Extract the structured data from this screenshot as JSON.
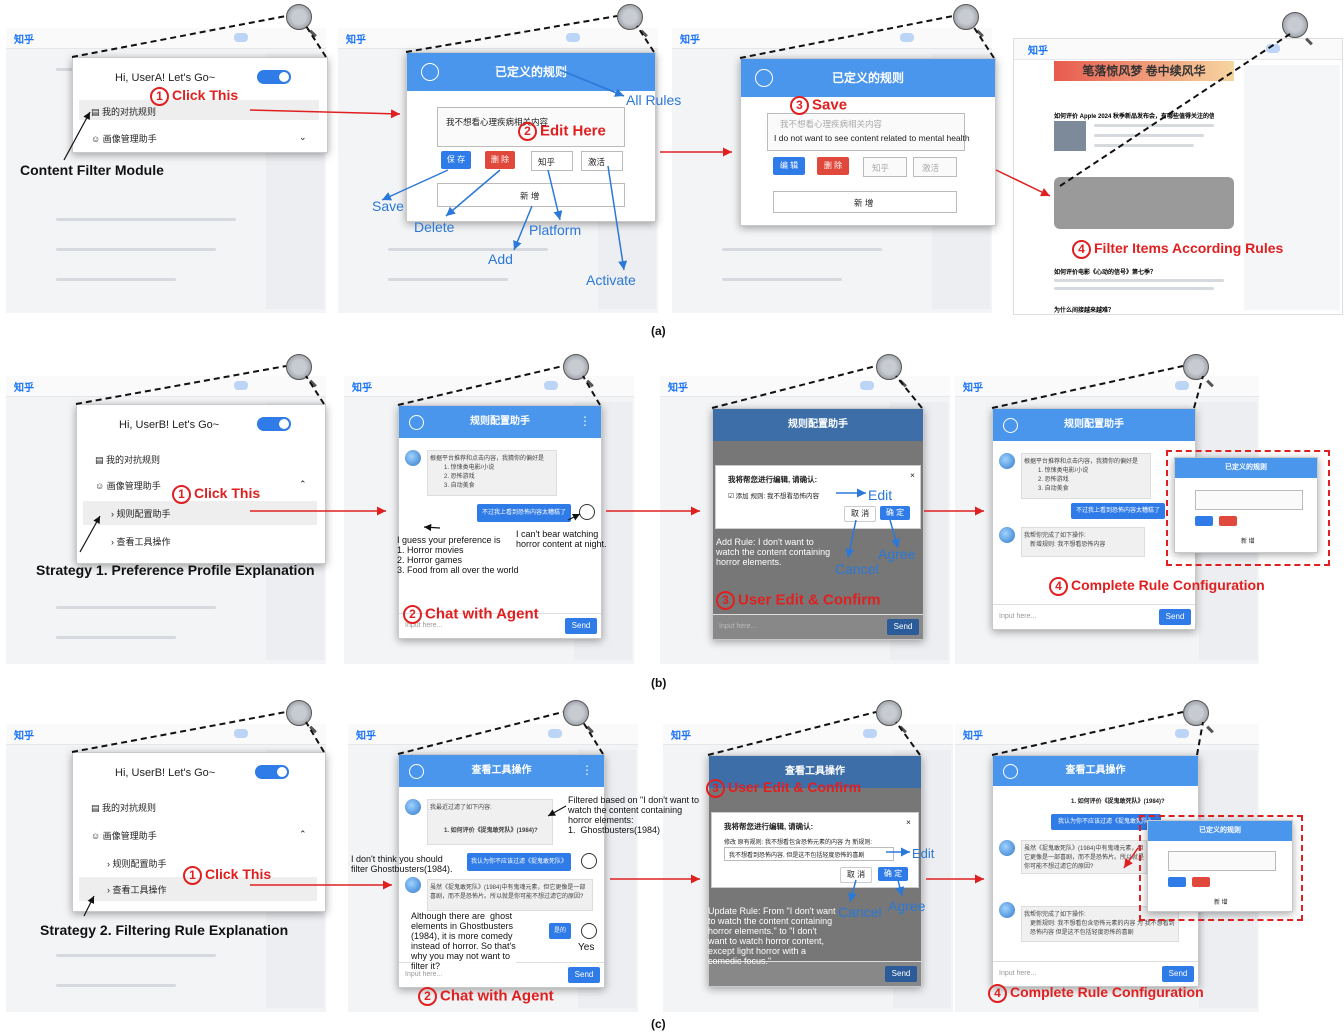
{
  "captions": {
    "a": "(a)",
    "b": "(b)",
    "c": "(c)"
  },
  "app_logo": "知乎",
  "row_a": {
    "home": {
      "greeting": "Hi, UserA! Let's Go~",
      "item1": "我的对抗规则",
      "item2": "画像管理助手"
    },
    "ann_click": "Click This",
    "ann_module": "Content Filter Module",
    "rules_panel": {
      "title": "已定义的规则",
      "rule_text": "我不想看心理疾病相关内容",
      "save": "保 存",
      "delete": "删 除",
      "platform": "知乎",
      "activate": "激活",
      "add": "新 增"
    },
    "ann_all_rules": "All Rules",
    "ann_edit_here": "Edit Here",
    "ann_save_btn": "Save",
    "ann_delete": "Delete",
    "ann_add": "Add",
    "ann_platform": "Platform",
    "ann_activate": "Activate",
    "saved_panel": {
      "title": "已定义的规则",
      "rule_text": "我不想看心理疾病相关内容",
      "rule_en": "I do not want to see content related to mental health",
      "edit": "编 辑",
      "delete": "删 除",
      "platform": "知乎",
      "activate": "激活",
      "add": "新 增"
    },
    "ann_save": "Save",
    "ann_filter": "Filter Items According Rules",
    "feed_question": "如何评价 Apple 2024 秋季新品发布会，有哪些值得关注的信息？",
    "feed_question2": "如何评价电影《心动的信号》第七季？",
    "feed_question3": "为什么间接越来越难？",
    "banner_text": "笔落惊风梦 卷中续风华"
  },
  "row_b": {
    "home": {
      "greeting": "Hi, UserB! Let's Go~",
      "item1": "我的对抗规则",
      "item2": "画像管理助手",
      "sub1": "规则配置助手",
      "sub2": "查看工具操作"
    },
    "ann_click": "Click This",
    "ann_strategy": "Strategy 1. Preference Profile Explanation",
    "chat": {
      "title": "规则配置助手",
      "agent_msg": "根据平台推荐和点击内容，我猜你的偏好是",
      "prefs": [
        "1. 惊悚类电影/小说",
        "2. 恐怖游戏",
        "3. 自动美食"
      ],
      "user_msg": "不过我上看到恐怖内容太糟糕了",
      "input_placeholder": "Input here...",
      "send": "Send"
    },
    "ann_guess": "I guess your preference is\n1. Horror movies\n2. Horror games\n3. Food from all over the world",
    "ann_cant": "I can't bear watching\nhorror content at night.",
    "ann_chat": "Chat with Agent",
    "confirm": {
      "title": "我将帮您进行编辑, 请确认:",
      "rule": "添加 规则: 我不想看恐怖内容",
      "cancel": "取 消",
      "ok": "确 定"
    },
    "ann_edit": "Edit",
    "ann_addrule": "Add Rule: I don't want to\nwatch the content containing\nhorror elements.",
    "ann_cancel": "Cancel",
    "ann_agree": "Agree",
    "ann_user_edit": "User Edit & Confirm",
    "done": {
      "title": "规则配置助手",
      "done_msg": "我帮你完成了如下操作:",
      "done_item": "新增规则: 我不想看恐怖内容"
    },
    "mini": {
      "title": "已定义的规则",
      "add": "新 增"
    },
    "ann_complete": "Complete Rule Configuration"
  },
  "row_c": {
    "home": {
      "greeting": "Hi, UserB! Let's Go~",
      "item1": "我的对抗规则",
      "item2": "画像管理助手",
      "sub1": "规则配置助手",
      "sub2": "查看工具操作"
    },
    "ann_click": "Click This",
    "ann_strategy": "Strategy 2. Filtering Rule Explanation",
    "chat": {
      "title": "查看工具操作",
      "agent_msg": "我最近过滤了如下内容:",
      "filtered": "1. 如何评价《捉鬼敢死队》(1984)?",
      "user_msg": "我认为你不应该过滤《捉鬼敢死队》",
      "agent_msg2": "虽然《捉鬼敢死队》(1984)中有鬼魂元素，但它更像是一部喜剧，而不是恐怖片。所以就是你可能不想过滤它的原因?",
      "yes": "是的",
      "input_placeholder": "Input here...",
      "send": "Send"
    },
    "ann_filtered": "Filtered based on \"I don't want to\nwatch the content containing\nhorror elements:\n1.  Ghostbusters(1984)",
    "ann_dont": "I don't think you should\nfilter Ghostbusters(1984).",
    "ann_although": "Although there are  ghost\nelements in Ghostbusters\n(1984), it is more comedy\ninstead of horror. So that's\nwhy you may not want to\nfilter it?",
    "ann_yes": "Yes",
    "ann_chat": "Chat with Agent",
    "confirm": {
      "title": "我将帮您进行编辑, 请确认:",
      "rule": "修改 原有规则: 我不想看包含恐怖元素的内容 为 新规则:",
      "rule2": "我不想看到恐怖内容, 但是这不包括轻度恐怖的喜剧",
      "cancel": "取 消",
      "ok": "确 定"
    },
    "ann_edit": "Edit",
    "ann_update": "Update Rule: From \"I don't want\nto watch the content containing\nhorror elements.\" to \"I don't\nwant to watch horror content,\nexcept light horror with a\ncomedic focus.\"",
    "ann_cancel": "Cancel",
    "ann_agree": "Agree",
    "ann_user_edit": "User Edit & Confirm",
    "done": {
      "title": "查看工具操作",
      "filtered": "1. 如何评价《捉鬼敢死队》(1984)?",
      "user_msg": "我认为你不应该过滤《捉鬼敢死队》",
      "agent_msg2": "虽然《捉鬼敢死队》(1984)中有鬼魂元素，但它更像是一部喜剧，而不是恐怖片。所以就是你可能不想过滤它的原因?",
      "done_msg": "我帮你完成了如下操作:",
      "done_item": "更新规则: 我不想看包含恐怖元素的内容 为 我不想看到恐怖内容 但是这不包括轻度恐怖的喜剧"
    },
    "mini": {
      "title": "已定义的规则",
      "add": "新 增"
    },
    "ann_complete": "Complete Rule Configuration"
  },
  "numbers": {
    "n1": "1",
    "n2": "2",
    "n3": "3",
    "n4": "4"
  },
  "colors": {
    "red": "#e02020",
    "blue": "#2a78d8",
    "header": "#4a96ec"
  }
}
